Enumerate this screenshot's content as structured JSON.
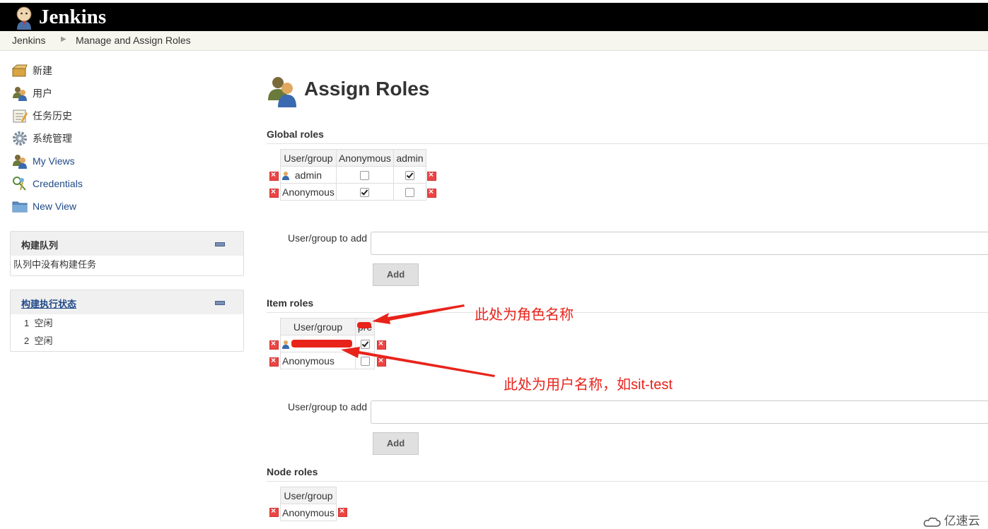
{
  "header": {
    "logo_text": "Jenkins"
  },
  "breadcrumbs": [
    "Jenkins",
    "Manage and Assign Roles"
  ],
  "sidebar": {
    "tasks": [
      {
        "label": "新建",
        "icon": "new-item-icon"
      },
      {
        "label": "用户",
        "icon": "users-icon"
      },
      {
        "label": "任务历史",
        "icon": "history-icon"
      },
      {
        "label": "系统管理",
        "icon": "gear-icon"
      },
      {
        "label": "My Views",
        "icon": "users-icon"
      },
      {
        "label": "Credentials",
        "icon": "keys-icon"
      },
      {
        "label": "New View",
        "icon": "folder-icon"
      }
    ],
    "build_queue": {
      "title": "构建队列",
      "empty_text": "队列中没有构建任务"
    },
    "executors": {
      "title": "构建执行状态",
      "rows": [
        {
          "num": "1",
          "status": "空闲"
        },
        {
          "num": "2",
          "status": "空闲"
        }
      ]
    }
  },
  "main": {
    "title": "Assign Roles",
    "global_roles": {
      "heading": "Global roles",
      "columns": [
        "User/group",
        "Anonymous",
        "admin"
      ],
      "rows": [
        {
          "name": "admin",
          "checks": [
            false,
            true
          ]
        },
        {
          "name": "Anonymous",
          "checks": [
            true,
            false
          ]
        }
      ],
      "add_label": "User/group to add",
      "add_button": "Add"
    },
    "item_roles": {
      "heading": "Item roles",
      "columns": [
        "User/group",
        "pre"
      ],
      "rows": [
        {
          "name": "",
          "checks": [
            true
          ]
        },
        {
          "name": "Anonymous",
          "checks": [
            false
          ]
        }
      ],
      "add_label": "User/group to add",
      "add_button": "Add"
    },
    "node_roles": {
      "heading": "Node roles",
      "columns": [
        "User/group"
      ],
      "rows": [
        {
          "name": "Anonymous"
        }
      ]
    }
  },
  "annotations": {
    "role_name_note": "此处为角色名称",
    "user_name_note": "此处为用户名称，如sit-test"
  },
  "watermark": "亿速云",
  "colors": {
    "annotation_red": "#e8231a",
    "header_bg": "#000000",
    "link_blue": "#204a87"
  }
}
